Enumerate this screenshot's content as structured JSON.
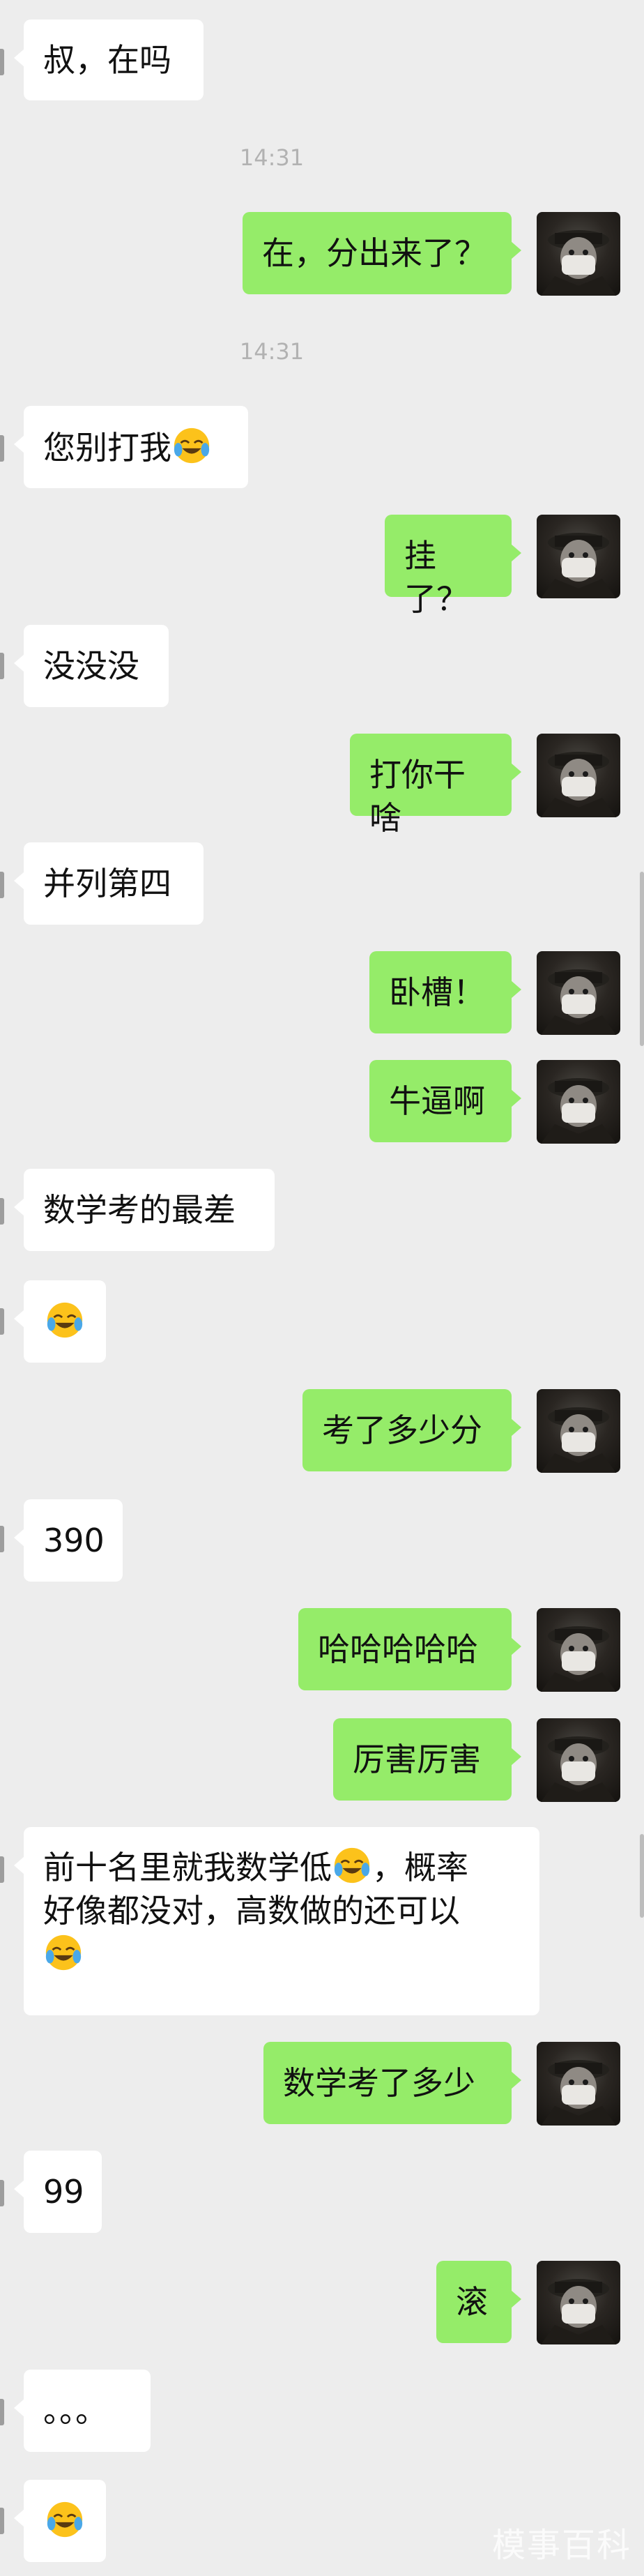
{
  "messages": [
    {
      "type": "text",
      "side": "in",
      "text": "叔，在吗"
    },
    {
      "type": "time",
      "text": "14:31"
    },
    {
      "type": "text",
      "side": "out",
      "text": "在，分出来了？"
    },
    {
      "type": "time",
      "text": "14:31"
    },
    {
      "type": "text",
      "side": "in",
      "text": "您别打我",
      "emoji": "laughing-crying-emoji"
    },
    {
      "type": "text",
      "side": "out",
      "text": "挂了？"
    },
    {
      "type": "text",
      "side": "in",
      "text": "没没没"
    },
    {
      "type": "text",
      "side": "out",
      "text": "打你干啥"
    },
    {
      "type": "text",
      "side": "in",
      "text": "并列第四"
    },
    {
      "type": "text",
      "side": "out",
      "text": "卧槽！"
    },
    {
      "type": "text",
      "side": "out",
      "text": "牛逼啊"
    },
    {
      "type": "text",
      "side": "in",
      "text": "数学考的最差"
    },
    {
      "type": "text",
      "side": "in",
      "text": "",
      "emoji": "laughing-crying-emoji"
    },
    {
      "type": "text",
      "side": "out",
      "text": "考了多少分"
    },
    {
      "type": "text",
      "side": "in",
      "text": "390"
    },
    {
      "type": "text",
      "side": "out",
      "text": "哈哈哈哈哈"
    },
    {
      "type": "text",
      "side": "out",
      "text": "厉害厉害"
    },
    {
      "type": "text",
      "side": "in",
      "lines": [
        "前十名里就我数学低",
        "，概率",
        "好像都没对，高数做的还可以",
        ""
      ],
      "emoji": "laughing-crying-emoji"
    },
    {
      "type": "text",
      "side": "out",
      "text": "数学考了多少"
    },
    {
      "type": "text",
      "side": "in",
      "text": "99"
    },
    {
      "type": "text",
      "side": "out",
      "text": "滚"
    },
    {
      "type": "text",
      "side": "in",
      "text": "。。。"
    },
    {
      "type": "text",
      "side": "in",
      "text": "",
      "emoji": "laughing-crying-emoji"
    }
  ],
  "avatar_icon": "masked-soldier-avatar",
  "colors": {
    "background": "#ededed",
    "incoming": "#ffffff",
    "outgoing": "#95ec69",
    "timestamp": "#b2b2b2"
  },
  "watermark": "模事百科"
}
